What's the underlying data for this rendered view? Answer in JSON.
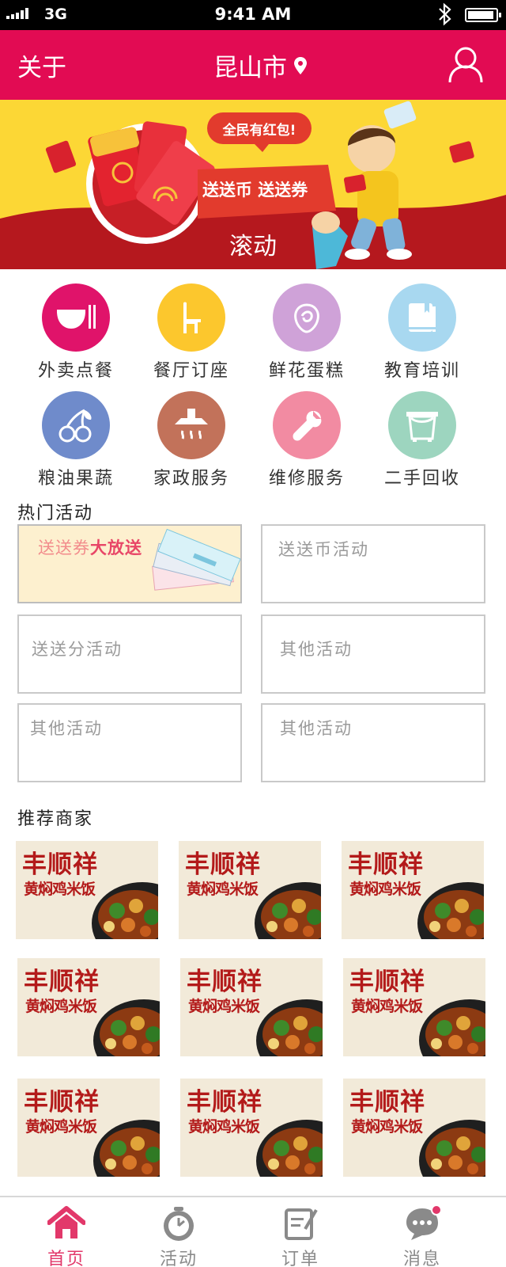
{
  "status_bar": {
    "carrier": "3G",
    "time": "9:41 AM"
  },
  "header": {
    "left_label": "关于",
    "city": "昆山市",
    "user_icon": "user-icon",
    "pin_icon": "location-pin-icon"
  },
  "banner": {
    "caption": "滚动",
    "bubble_text": "全民有红包!",
    "ribbon_text": "送送币 送送券",
    "colors": {
      "background": "#fcd735",
      "wave": "#b5181e"
    }
  },
  "categories": [
    {
      "label": "外卖点餐",
      "icon": "bowl-chopsticks-icon",
      "color": "#e0136a"
    },
    {
      "label": "餐厅订座",
      "icon": "chair-icon",
      "color": "#fcc72d"
    },
    {
      "label": "鲜花蛋糕",
      "icon": "rose-icon",
      "color": "#cfa2d8"
    },
    {
      "label": "教育培训",
      "icon": "book-icon",
      "color": "#a8d8f0"
    },
    {
      "label": "粮油果蔬",
      "icon": "cherry-icon",
      "color": "#6f8bcb"
    },
    {
      "label": "家政服务",
      "icon": "range-hood-icon",
      "color": "#c2725a"
    },
    {
      "label": "维修服务",
      "icon": "wrench-icon",
      "color": "#f28ba2"
    },
    {
      "label": "二手回收",
      "icon": "recycle-bin-icon",
      "color": "#9dd5bf"
    }
  ],
  "hot_section": {
    "title": "热门活动"
  },
  "activities": [
    {
      "text_pre": "送送券",
      "text_bold": "大放送"
    },
    {
      "text": "送送币活动"
    },
    {
      "text": "送送分活动"
    },
    {
      "text": "其他活动"
    },
    {
      "text": "其他活动"
    },
    {
      "text": "其他活动"
    }
  ],
  "merchant_section": {
    "title": "推荐商家"
  },
  "merchants": [
    {
      "name": "丰顺祥",
      "dish": "黄焖鸡米饭"
    },
    {
      "name": "丰顺祥",
      "dish": "黄焖鸡米饭"
    },
    {
      "name": "丰顺祥",
      "dish": "黄焖鸡米饭"
    },
    {
      "name": "丰顺祥",
      "dish": "黄焖鸡米饭"
    },
    {
      "name": "丰顺祥",
      "dish": "黄焖鸡米饭"
    },
    {
      "name": "丰顺祥",
      "dish": "黄焖鸡米饭"
    },
    {
      "name": "丰顺祥",
      "dish": "黄焖鸡米饭"
    },
    {
      "name": "丰顺祥",
      "dish": "黄焖鸡米饭"
    },
    {
      "name": "丰顺祥",
      "dish": "黄焖鸡米饭"
    }
  ],
  "tabbar": {
    "active_color": "#e2386a",
    "items": [
      {
        "label": "首页",
        "icon": "home-icon"
      },
      {
        "label": "活动",
        "icon": "timer-icon"
      },
      {
        "label": "订单",
        "icon": "order-icon"
      },
      {
        "label": "消息",
        "icon": "message-icon"
      }
    ]
  }
}
